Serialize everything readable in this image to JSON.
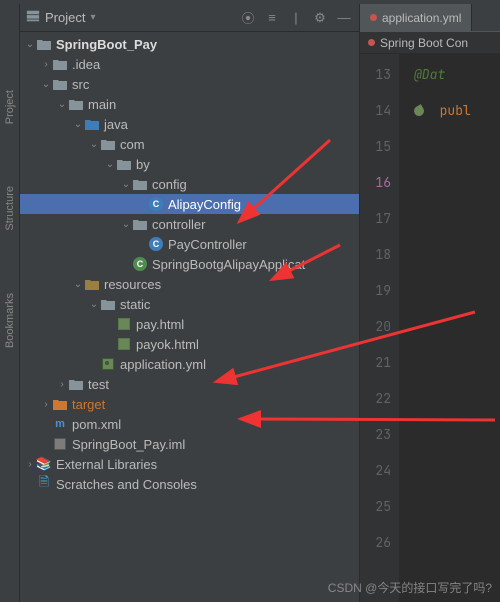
{
  "panel": {
    "title": "Project"
  },
  "tree": {
    "root": "SpringBoot_Pay",
    "idea": ".idea",
    "src": "src",
    "main": "main",
    "java": "java",
    "com": "com",
    "by": "by",
    "config": "config",
    "alipay_config": "AlipayConfig",
    "controller": "controller",
    "pay_controller": "PayController",
    "app_class": "SpringBootgAlipayApplicat",
    "resources": "resources",
    "static": "static",
    "pay_html": "pay.html",
    "payok_html": "payok.html",
    "application_yml": "application.yml",
    "test": "test",
    "target": "target",
    "pom": "pom.xml",
    "iml": "SpringBoot_Pay.iml",
    "external": "External Libraries",
    "scratches": "Scratches and Consoles"
  },
  "editor": {
    "tab1": "application.yml",
    "breadcrumb": "Spring Boot Con",
    "lines": [
      "13",
      "14",
      "15",
      "16",
      "17",
      "18",
      "19",
      "20",
      "21",
      "22",
      "23",
      "24",
      "25",
      "26"
    ],
    "highlight_line": "16",
    "code_anno": "@Dat",
    "code_kw": "publ"
  },
  "watermark": "CSDN @今天的接口写完了吗?"
}
